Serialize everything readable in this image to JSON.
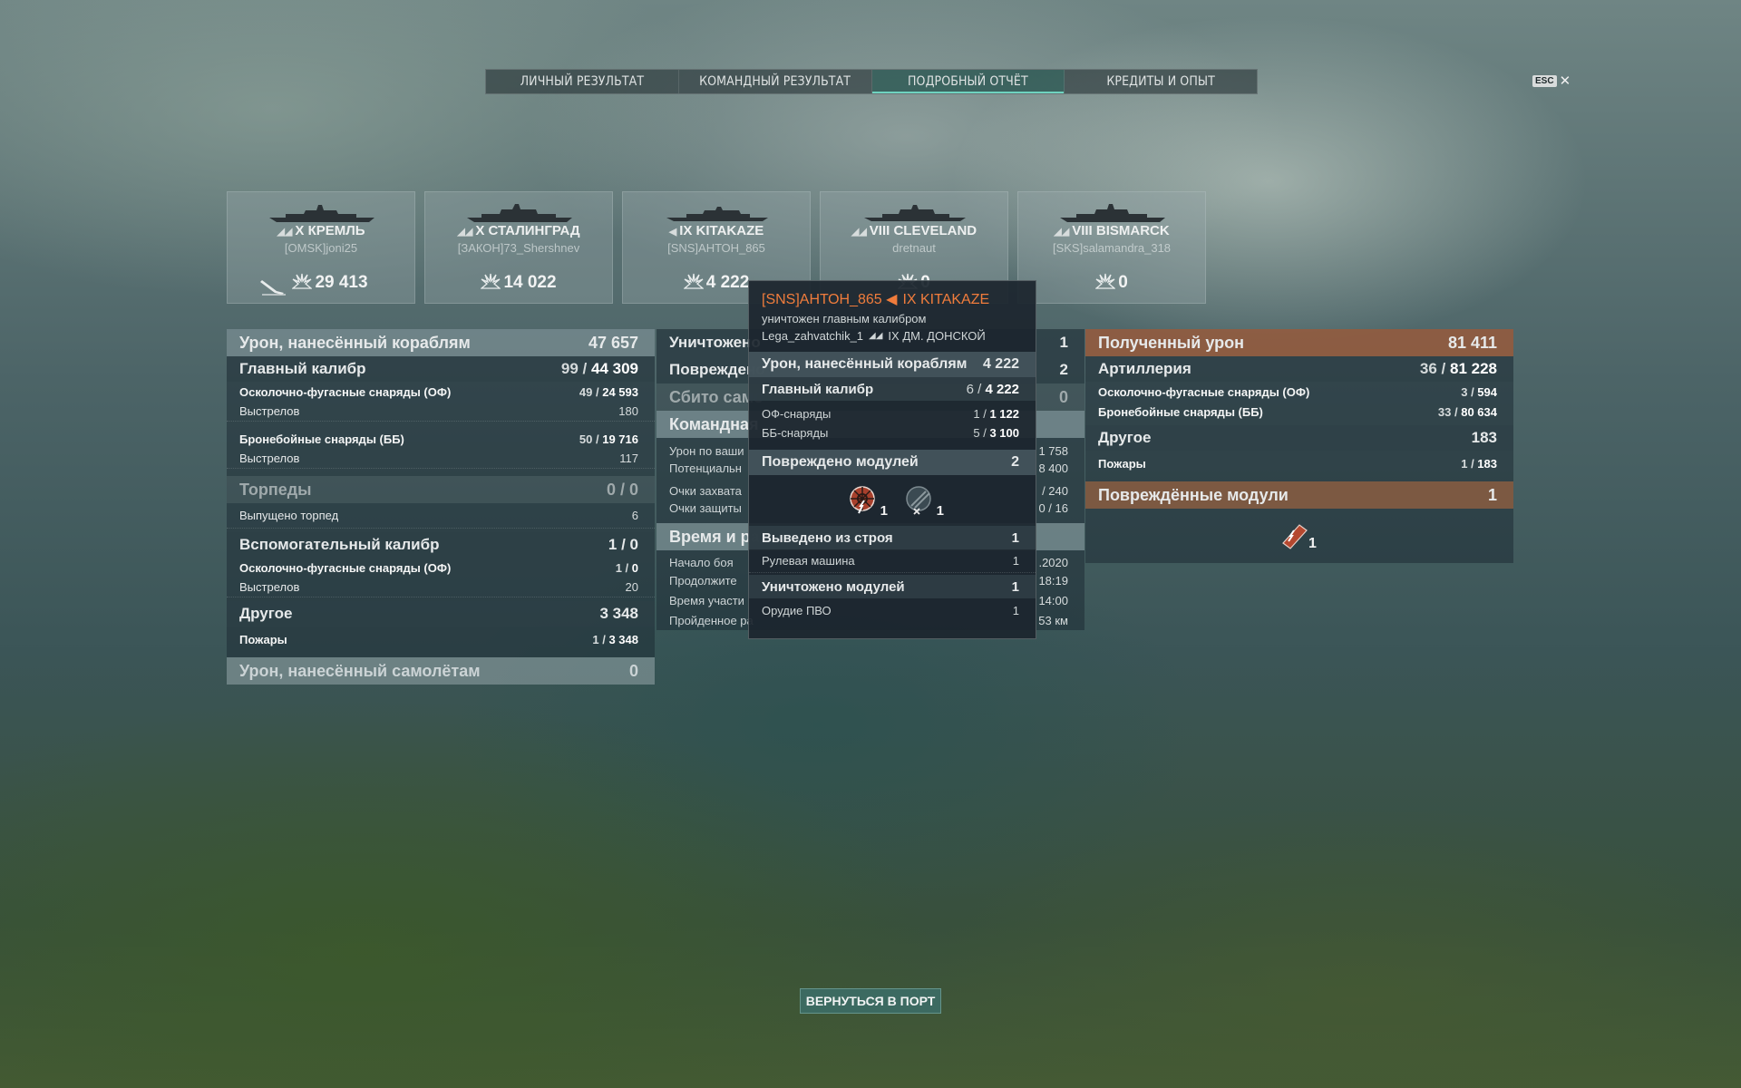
{
  "tabs": [
    {
      "label": "ЛИЧНЫЙ РЕЗУЛЬТАТ",
      "active": false
    },
    {
      "label": "КОМАНДНЫЙ РЕЗУЛЬТАТ",
      "active": false
    },
    {
      "label": "ПОДРОБНЫЙ ОТЧЁТ",
      "active": true
    },
    {
      "label": "КРЕДИТЫ И ОПЫТ",
      "active": false
    }
  ],
  "esc": {
    "key": "ESC",
    "close": "✕"
  },
  "ships": [
    {
      "tier": "X",
      "name": "КРЕМЛЬ",
      "player": "[OMSK]joni25",
      "damage": "29 413",
      "killed": true
    },
    {
      "tier": "X",
      "name": "СТАЛИНГРАД",
      "player": "[ЗАКОН]73_Shershnev",
      "damage": "14 022",
      "killed": false
    },
    {
      "tier": "IX",
      "name": "KITAKAZE",
      "player": "[SNS]АНТОН_865",
      "damage": "4 222",
      "killed": false
    },
    {
      "tier": "VIII",
      "name": "CLEVELAND",
      "player": "dretnaut",
      "damage": "0",
      "killed": false
    },
    {
      "tier": "VIII",
      "name": "BISMARCK",
      "player": "[SKS]salamandra_318",
      "damage": "0",
      "killed": false
    }
  ],
  "left": {
    "damage_header": {
      "label": "Урон, нанесённый кораблям",
      "value": "47 657"
    },
    "main_battery": {
      "label": "Главный калибр",
      "hits": "99",
      "value": "44 309"
    },
    "he_shells": {
      "label": "Осколочно-фугасные снаряды (ОФ)",
      "hits": "49",
      "value": "24 593"
    },
    "he_shots": {
      "label": "Выстрелов",
      "value": "180"
    },
    "ap_shells": {
      "label": "Бронебойные снаряды (ББ)",
      "hits": "50",
      "value": "19 716"
    },
    "ap_shots": {
      "label": "Выстрелов",
      "value": "117"
    },
    "torpedoes": {
      "label": "Торпеды",
      "value": "0 / 0"
    },
    "torp_fired": {
      "label": "Выпущено торпед",
      "value": "6"
    },
    "secondary": {
      "label": "Вспомогательный калибр",
      "value": "1 / 0"
    },
    "sec_he": {
      "label": "Осколочно-фугасные снаряды (ОФ)",
      "hits": "1",
      "value": "0"
    },
    "sec_shots": {
      "label": "Выстрелов",
      "value": "20"
    },
    "other": {
      "label": "Другое",
      "value": "3 348"
    },
    "fires": {
      "label": "Пожары",
      "hits": "1",
      "value": "3 348"
    },
    "planes": {
      "label": "Урон, нанесённый самолётам",
      "value": "0"
    }
  },
  "middle": {
    "destroyed": {
      "label": "Уничтожено",
      "value": "1"
    },
    "damaged": {
      "label": "Повреждено",
      "value": "2"
    },
    "shot_down": {
      "label": "Сбито само",
      "value": "0"
    },
    "team": {
      "label": "Командная"
    },
    "spotting_damage": {
      "label": "Урон по ваши",
      "value": "1 758"
    },
    "potential": {
      "label": "Потенциальн",
      "value": "8 400"
    },
    "capture": {
      "label": "Очки захвата",
      "value": "/ 240"
    },
    "defense": {
      "label": "Очки защиты",
      "value": "0 / 16"
    },
    "time_header": {
      "label": "Время и ра"
    },
    "battle_start": {
      "label": "Начало боя",
      "value": ".2020"
    },
    "duration": {
      "label": "Продолжите",
      "value": "18:19"
    },
    "participation": {
      "label": "Время участи",
      "value": "14:00"
    },
    "distance": {
      "label": "Пройденное ра",
      "value": "53 км"
    }
  },
  "right": {
    "received_header": {
      "label": "Полученный урон",
      "value": "81 411"
    },
    "artillery": {
      "label": "Артиллерия",
      "hits": "36",
      "value": "81 228"
    },
    "he": {
      "label": "Осколочно-фугасные снаряды (ОФ)",
      "hits": "3",
      "value": "594"
    },
    "ap": {
      "label": "Бронебойные снаряды (ББ)",
      "hits": "33",
      "value": "80 634"
    },
    "other": {
      "label": "Другое",
      "value": "183"
    },
    "fires": {
      "label": "Пожары",
      "hits": "1",
      "value": "183"
    },
    "damaged_modules": {
      "label": "Повреждённые модули",
      "value": "1"
    },
    "module_count": "1"
  },
  "tooltip": {
    "player": "[SNS]АНТОН_865",
    "ship": "IX KITAKAZE",
    "death_text": "уничтожен главным калибром",
    "killer": "Lega_zahvatchik_1",
    "killer_ship": "IX ДМ. ДОНСКОЙ",
    "damage": {
      "label": "Урон, нанесённый кораблям",
      "value": "4 222"
    },
    "main": {
      "label": "Главный калибр",
      "hits": "6",
      "value": "4 222"
    },
    "he": {
      "label": "ОФ-снаряды",
      "hits": "1",
      "value": "1 122"
    },
    "ap": {
      "label": "ББ-снаряды",
      "hits": "5",
      "value": "3 100"
    },
    "modules": {
      "label": "Повреждено модулей",
      "value": "2"
    },
    "mod1_count": "1",
    "mod2_count": "1",
    "incapacitated": {
      "label": "Выведено из строя",
      "value": "1"
    },
    "steering": {
      "label": "Рулевая машина",
      "value": "1"
    },
    "destroyed_mods": {
      "label": "Уничтожено модулей",
      "value": "1"
    },
    "aa_gun": {
      "label": "Орудие ПВО",
      "value": "1"
    }
  },
  "back_button": "ВЕРНУТЬСЯ В ПОРТ",
  "colors": {
    "accent": "#6fd3c0",
    "tooltip_title": "#f07c3c",
    "received": "#965a3c"
  }
}
